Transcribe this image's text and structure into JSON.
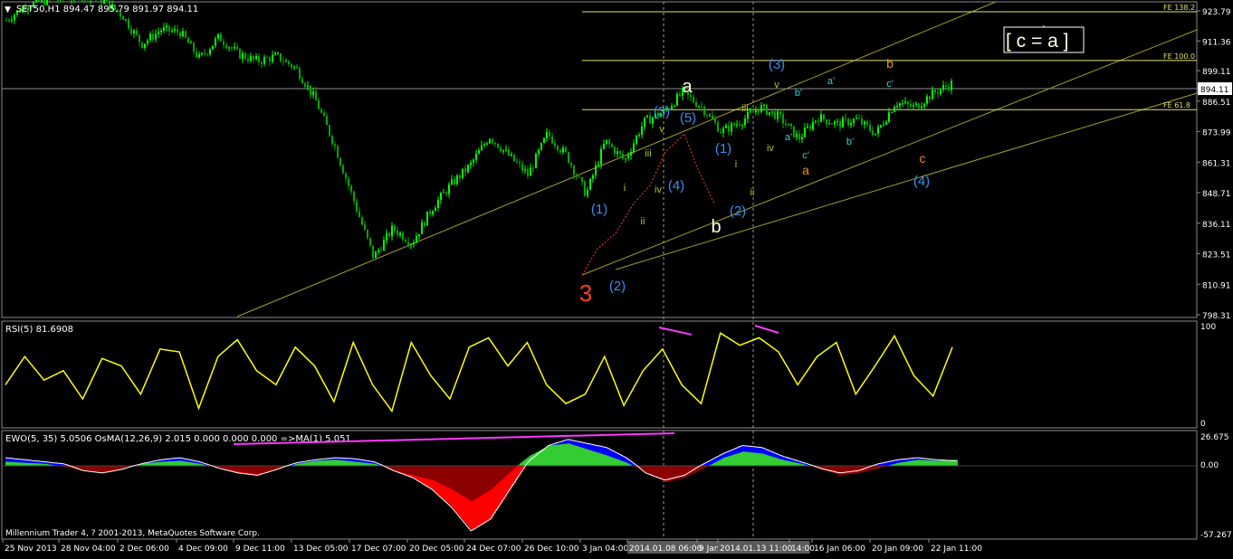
{
  "main": {
    "symbol_header": "SET50,H1  894.47 895.79 891.97 894.11",
    "current_price": "894.11",
    "price_ticks": [
      "923.79",
      "911.36",
      "899.11",
      "886.51",
      "873.99",
      "861.31",
      "848.71",
      "836.11",
      "823.51",
      "810.91",
      "798.31"
    ],
    "fib_levels": [
      {
        "label": "FE 138.2",
        "price": 923.4
      },
      {
        "label": "FE 100.0",
        "price": 903.3
      },
      {
        "label": "FE 61.8",
        "price": 883.0
      }
    ],
    "callout": "[ c = a ]",
    "wave_labels": [
      {
        "text": "3",
        "color": "#ff3b1f",
        "size": 26,
        "x": 647,
        "y": 333
      },
      {
        "text": "(1)",
        "color": "#3a8ff0",
        "size": 15,
        "x": 662,
        "y": 236
      },
      {
        "text": "(2)",
        "color": "#3a8ff0",
        "size": 15,
        "x": 682,
        "y": 321
      },
      {
        "text": "i",
        "color": "#a8c828",
        "size": 11,
        "x": 690,
        "y": 211
      },
      {
        "text": "ii",
        "color": "#a8c828",
        "size": 11,
        "x": 710,
        "y": 248
      },
      {
        "text": "iii",
        "color": "#a8c828",
        "size": 11,
        "x": 716,
        "y": 173
      },
      {
        "text": "iv",
        "color": "#a8c828",
        "size": 11,
        "x": 727,
        "y": 213
      },
      {
        "text": "v",
        "color": "#a8c828",
        "size": 11,
        "x": 731,
        "y": 146
      },
      {
        "text": "(3)",
        "color": "#3a8ff0",
        "size": 15,
        "x": 731,
        "y": 128
      },
      {
        "text": "(4)",
        "color": "#3a8ff0",
        "size": 15,
        "x": 747,
        "y": 210
      },
      {
        "text": "(5)",
        "color": "#3a8ff0",
        "size": 15,
        "x": 760,
        "y": 135
      },
      {
        "text": "a",
        "color": "#ffffe0",
        "size": 20,
        "x": 759,
        "y": 102
      },
      {
        "text": "b",
        "color": "#ffffe0",
        "size": 20,
        "x": 791,
        "y": 257
      },
      {
        "text": "(1)",
        "color": "#3a8ff0",
        "size": 15,
        "x": 799,
        "y": 169
      },
      {
        "text": "(2)",
        "color": "#3a8ff0",
        "size": 15,
        "x": 815,
        "y": 238
      },
      {
        "text": "i",
        "color": "#a8c828",
        "size": 11,
        "x": 813,
        "y": 185
      },
      {
        "text": "ii",
        "color": "#a8c828",
        "size": 11,
        "x": 831,
        "y": 216
      },
      {
        "text": "iii",
        "color": "#a8c828",
        "size": 11,
        "x": 823,
        "y": 123
      },
      {
        "text": "iv",
        "color": "#a8c828",
        "size": 11,
        "x": 851,
        "y": 167
      },
      {
        "text": "v",
        "color": "#a8c828",
        "size": 11,
        "x": 858,
        "y": 97
      },
      {
        "text": "(3)",
        "color": "#3a8ff0",
        "size": 15,
        "x": 858,
        "y": 76
      },
      {
        "text": "b'",
        "color": "#2ecfd8",
        "size": 11,
        "x": 882,
        "y": 106
      },
      {
        "text": "a'",
        "color": "#2ecfd8",
        "size": 11,
        "x": 871,
        "y": 155
      },
      {
        "text": "c'",
        "color": "#2ecfd8",
        "size": 11,
        "x": 890,
        "y": 175
      },
      {
        "text": "a",
        "color": "#e8901c",
        "size": 14,
        "x": 890,
        "y": 193
      },
      {
        "text": "a'",
        "color": "#2ecfd8",
        "size": 11,
        "x": 918,
        "y": 93
      },
      {
        "text": "b'",
        "color": "#2ecfd8",
        "size": 11,
        "x": 939,
        "y": 160
      },
      {
        "text": "b",
        "color": "#e8901c",
        "size": 14,
        "x": 983,
        "y": 75
      },
      {
        "text": "c'",
        "color": "#2ecfd8",
        "size": 11,
        "x": 983,
        "y": 96
      },
      {
        "text": "c",
        "color": "#e8901c",
        "size": 14,
        "x": 1019,
        "y": 180
      },
      {
        "text": "(4)",
        "color": "#3a8ff0",
        "size": 15,
        "x": 1018,
        "y": 205
      }
    ]
  },
  "rsi": {
    "header": "RSI(5) 81.6908",
    "ticks": [
      "100",
      "0"
    ]
  },
  "ewo": {
    "header": "EWO(5, 35) 5.0506  OsMA(12,26,9) 2.015 0.000 0.000 0.000   =>MA(1) 5.051",
    "ticks": [
      "26.675",
      "0.00",
      "-57.267"
    ]
  },
  "footer": {
    "copyright": "Millennium Trader 4, ? 2001-2013, MetaQuotes Software Corp."
  },
  "time_axis": {
    "labels": [
      "25 Nov 2013",
      "28 Nov 04:00",
      "2 Dec 06:00",
      "4 Dec 09:00",
      "9 Dec 11:00",
      "13 Dec 05:00",
      "17 Dec 07:00",
      "20 Dec 05:00",
      "24 Dec 07:00",
      "26 Dec 10:00",
      "3 Jan 04:00",
      "2014.01.08 06:00",
      "9 Jan 09:00",
      "2014.01.13 11:00",
      "14:00",
      "16 Jan 06:00",
      "20 Jan 09:00",
      "22 Jan 11:00"
    ],
    "highlighted": [
      "2014.01.08 06:00",
      "2014.01.13 11:00"
    ]
  },
  "colors": {
    "bull": "#00ff00",
    "bear": "#00a800",
    "grid": "#8c8c8c",
    "channel": "#a0a028",
    "fib": "#e0e070",
    "rsi_line": "#ffff00",
    "divergence": "#ff38ff",
    "ewo_pos": "#0000ff",
    "ewo_neg": "#ff0000",
    "osma_pos": "#33cc33",
    "osma_neg": "#8b0000"
  },
  "chart_data": [
    {
      "type": "candlestick",
      "title": "SET50,H1",
      "ylim": [
        798.31,
        930
      ],
      "x": [
        "25 Nov 2013",
        "28 Nov 04:00",
        "2 Dec 06:00",
        "4 Dec 09:00",
        "9 Dec 11:00",
        "13 Dec 05:00",
        "17 Dec 07:00",
        "20 Dec 05:00",
        "24 Dec 07:00",
        "26 Dec 10:00",
        "3 Jan 04:00",
        "2014.01.08 06:00",
        "9 Jan 09:00",
        "2014.01.13 11:00",
        "16 Jan 06:00",
        "20 Jan 09:00",
        "22 Jan 11:00"
      ],
      "close_path": [
        920,
        926,
        928,
        929,
        931,
        928,
        922,
        910,
        916,
        915,
        904,
        913,
        906,
        903,
        905,
        900,
        887,
        868,
        845,
        822,
        834,
        828,
        842,
        852,
        860,
        872,
        864,
        856,
        873,
        864,
        848,
        870,
        862,
        878,
        882,
        890,
        884,
        874,
        878,
        884,
        880,
        871,
        880,
        877,
        879,
        873,
        886,
        884,
        890,
        894
      ],
      "last": {
        "open": 894.47,
        "high": 895.79,
        "low": 891.97,
        "close": 894.11
      }
    },
    {
      "type": "line",
      "title": "RSI(5)",
      "ylim": [
        0,
        100
      ],
      "values": [
        40,
        70,
        45,
        55,
        25,
        68,
        60,
        30,
        78,
        75,
        15,
        70,
        88,
        55,
        40,
        80,
        60,
        22,
        85,
        40,
        12,
        85,
        50,
        25,
        80,
        90,
        60,
        85,
        40,
        20,
        30,
        70,
        18,
        55,
        78,
        40,
        20,
        95,
        82,
        90,
        75,
        40,
        70,
        85,
        30,
        60,
        92,
        50,
        28,
        80
      ],
      "last": 81.6908
    },
    {
      "type": "bar",
      "title": "EWO(5, 35) / OsMA(12,26,9)",
      "ylim": [
        -57.267,
        26.675
      ],
      "ewo": [
        8,
        6,
        4,
        2,
        -4,
        -6,
        -3,
        2,
        6,
        8,
        4,
        -2,
        -6,
        -8,
        -3,
        3,
        6,
        8,
        7,
        4,
        -4,
        -10,
        -20,
        -35,
        -55,
        -45,
        -20,
        5,
        20,
        26,
        22,
        18,
        8,
        -6,
        -12,
        -8,
        2,
        12,
        20,
        18,
        10,
        4,
        -2,
        -6,
        -4,
        2,
        6,
        8,
        6,
        5
      ],
      "osma": [
        4,
        3,
        2,
        -1,
        -4,
        -6,
        -3,
        2,
        4,
        5,
        2,
        -2,
        -5,
        -7,
        -3,
        2,
        5,
        6,
        4,
        2,
        -4,
        -8,
        -12,
        -20,
        -30,
        -20,
        -5,
        10,
        20,
        22,
        16,
        10,
        3,
        -6,
        -14,
        -10,
        -2,
        8,
        14,
        12,
        6,
        2,
        -3,
        -8,
        -6,
        -2,
        3,
        6,
        5,
        6
      ],
      "ma": 5.051
    }
  ]
}
